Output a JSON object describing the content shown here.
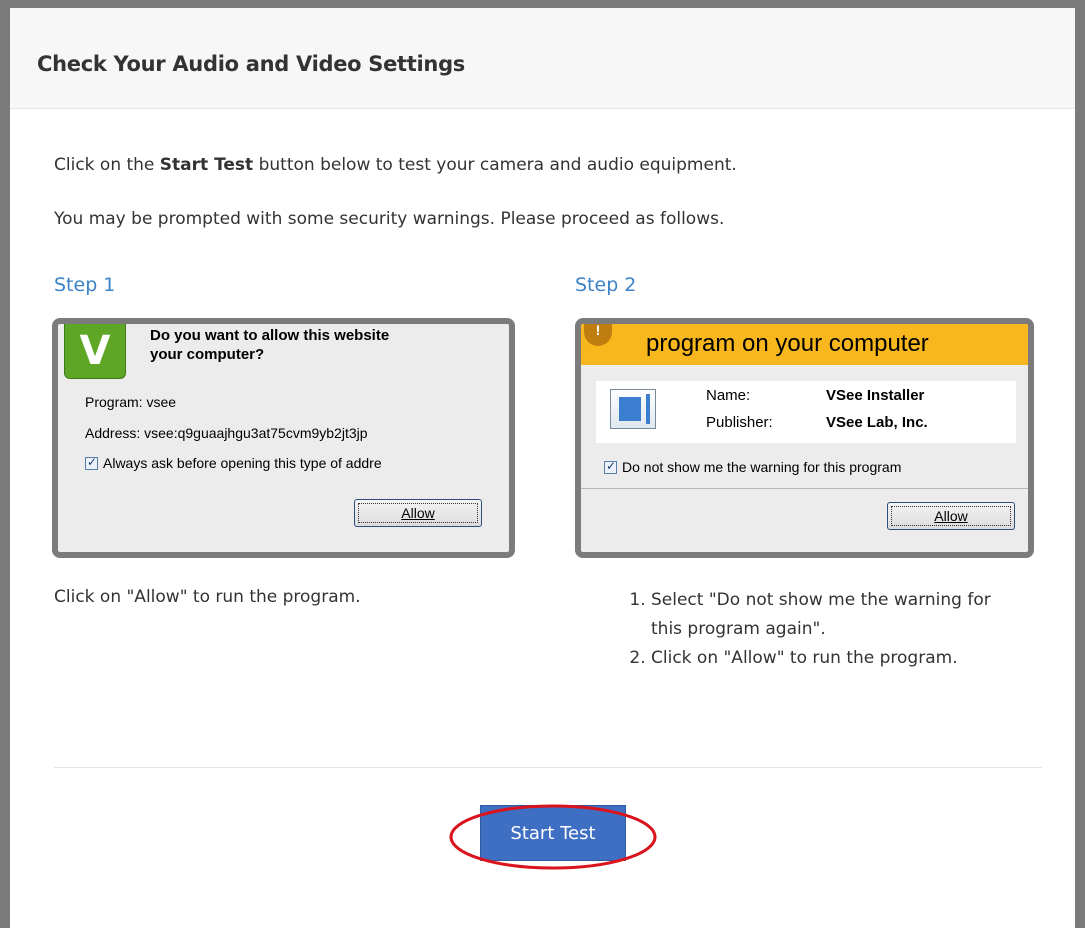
{
  "modal": {
    "title": "Check Your Audio and Video Settings"
  },
  "intro": {
    "line1_prefix": "Click on the ",
    "line1_bold": "Start Test",
    "line1_suffix": " button below to test your camera and audio equipment.",
    "line2": "You may be prompted with some security warnings. Please proceed as follows."
  },
  "step1": {
    "title": "Step 1",
    "screenshot": {
      "logo_letter": "V",
      "question_line1": "Do you want to allow this website",
      "question_line2": "your computer?",
      "program_line": "Program:  vsee",
      "address_line": "Address:  vsee:q9guaajhgu3at75cvm9yb2jt3jp",
      "checkbox_label": "Always ask before opening this type of addre",
      "checkbox_checked": true,
      "checkbox_mark": "✓",
      "allow_label": "Allow"
    },
    "caption": "Click on \"Allow\" to run the program."
  },
  "step2": {
    "title": "Step 2",
    "screenshot": {
      "banner_text": "program on your computer",
      "name_label": "Name:",
      "name_value": "VSee Installer",
      "publisher_label": "Publisher:",
      "publisher_value": "VSee Lab, Inc.",
      "checkbox_label": "Do not show me the warning for this program",
      "checkbox_checked": true,
      "checkbox_mark": "✓",
      "allow_label": "Allow",
      "banner_color": "#f8b71c"
    },
    "instructions": [
      "Select \"Do not show me the warning for this program again\".",
      "Click on \"Allow\" to run the program."
    ]
  },
  "footer": {
    "start_test_label": "Start Test",
    "start_test_color": "#3e6fc3",
    "highlight_color": "#d9141c"
  }
}
